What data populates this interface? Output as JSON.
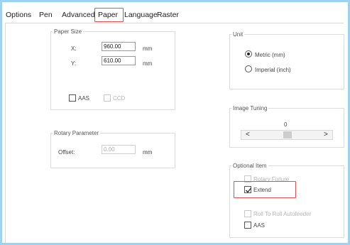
{
  "tabs": [
    "Options",
    "Pen",
    "Advanced",
    "Paper",
    "Language",
    "Raster"
  ],
  "paper_size": {
    "legend": "Paper Size",
    "x_label": "X:",
    "x_value": "960.00",
    "y_label": "Y:",
    "y_value": "610.00",
    "unit": "mm",
    "aas_label": "AAS",
    "ccd_label": "CCD"
  },
  "rotary": {
    "legend": "Rotary Parameter",
    "offset_label": "Offset:",
    "offset_value": "0.00",
    "unit": "mm"
  },
  "unit": {
    "legend": "Unit",
    "metric_label": "Metric (mm)",
    "imperial_label": "Imperial (inch)",
    "selected": "metric"
  },
  "image_tuning": {
    "legend": "Image Tuning",
    "value": "0",
    "left_arrow": "<",
    "right_arrow": ">"
  },
  "optional_item": {
    "legend": "Optional Item",
    "rotary_fixture_label": "Rotary Fixture",
    "extend_label": "Extend",
    "extend_checked": true,
    "roll_label": "Roll To Roll  Autofeeder",
    "aas_label": "AAS"
  },
  "colors": {
    "highlight": "#e05050",
    "background": "#9fd2f0"
  }
}
